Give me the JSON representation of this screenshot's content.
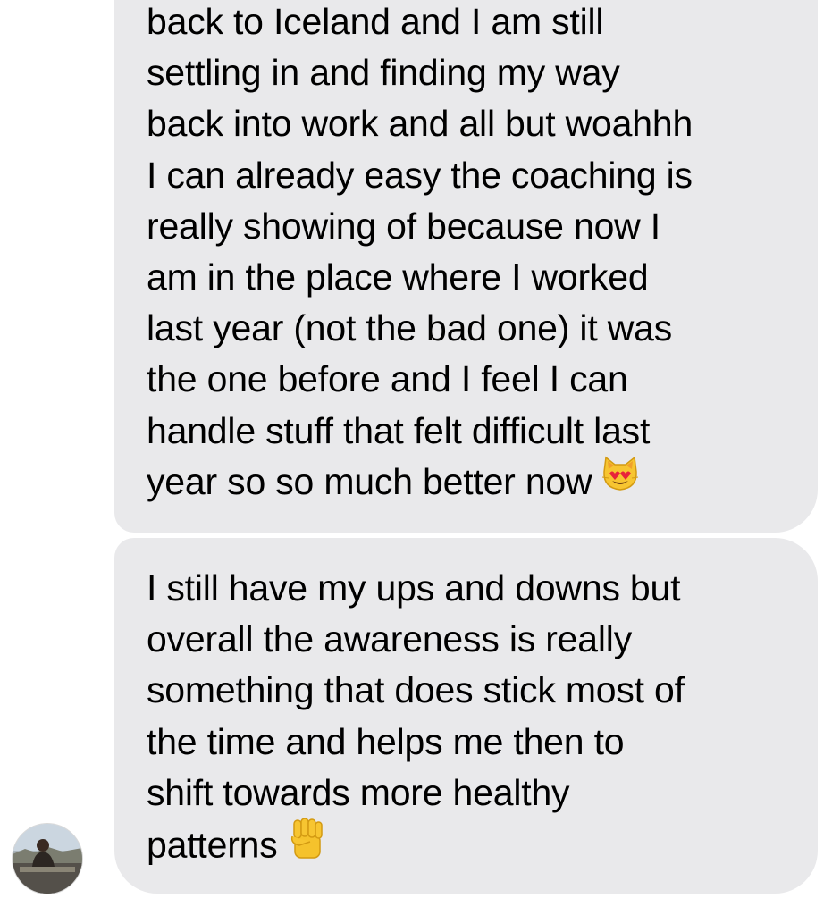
{
  "messages": [
    {
      "lines": [
        "back to Iceland and I am still",
        "settling in and finding my way",
        "back into work and all but woahhh",
        "I can already easy the coaching is",
        "really showing of because now I",
        "am in the place where I worked",
        "last year (not the bad one) it was",
        "the one before and I feel I can",
        "handle stuff that felt difficult last",
        "year so so much better now"
      ],
      "emoji": "heart-eyes-cat-emoji"
    },
    {
      "lines": [
        "I still have my ups and downs but",
        "overall the awareness is really",
        "something that does stick most of",
        "the time and helps me then to",
        "shift towards more healthy",
        "patterns"
      ],
      "emoji": "raised-fist-emoji"
    }
  ],
  "colors": {
    "bubble": "#e9e9eb",
    "text": "#000000",
    "background": "#ffffff"
  }
}
